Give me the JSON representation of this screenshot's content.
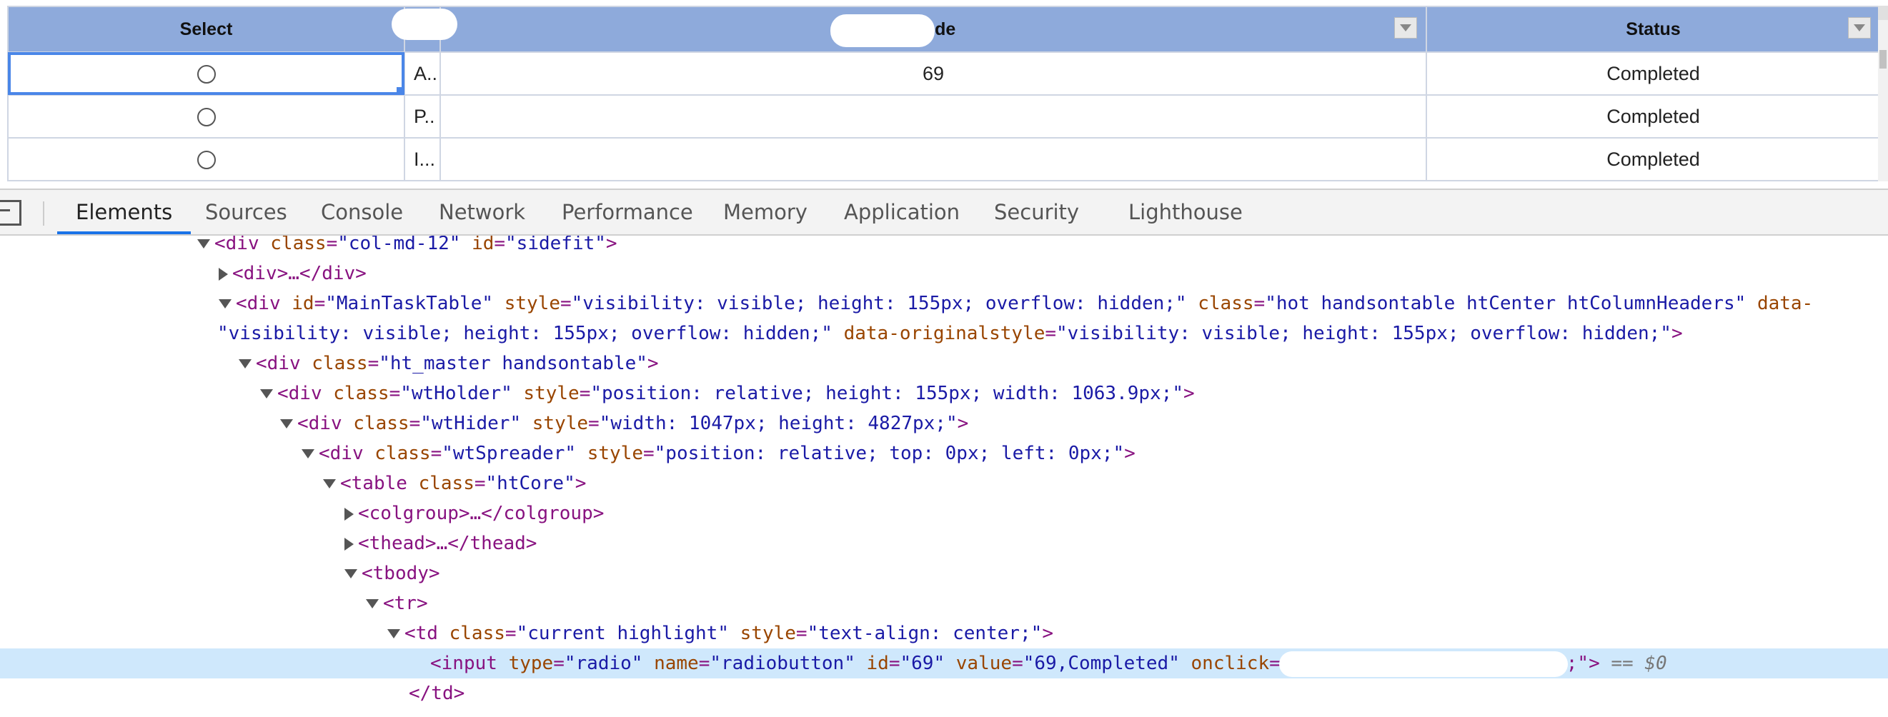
{
  "table": {
    "headers": {
      "select": "Select",
      "col2": "",
      "code": "Code",
      "status": "Status"
    },
    "rows": [
      {
        "col2": "A..",
        "code": "69",
        "status": "Completed"
      },
      {
        "col2": "P..",
        "code": "",
        "status": "Completed"
      },
      {
        "col2": "I...",
        "code": "",
        "status": "Completed"
      }
    ]
  },
  "devtools": {
    "tabs": [
      "Elements",
      "Sources",
      "Console",
      "Network",
      "Performance",
      "Memory",
      "Application",
      "Security",
      "Lighthouse"
    ],
    "active_tab": "Elements",
    "dom": {
      "l0": {
        "tag_open": "<div ",
        "a1": "class",
        "v1": "\"col-md-12\"",
        "a2": "id",
        "v2": "\"sidefit\"",
        "close": ">"
      },
      "l1": {
        "text": "<div>…</div>"
      },
      "l2": {
        "tag_open": "<div ",
        "a1": "id",
        "v1": "\"MainTaskTable\"",
        "a2": "style",
        "v2": "\"visibility: visible; height: 155px; overflow: hidden;\"",
        "a3": "class",
        "v3": "\"hot handsontable htCenter htColumnHeaders\"",
        "a4": "data-"
      },
      "l3": {
        "v": "\"visibility: visible; height: 155px; overflow: hidden;\"",
        "a": "data-originalstyle",
        "v2": "\"visibility: visible; height: 155px; overflow: hidden;\"",
        "close": ">"
      },
      "l4": {
        "tag_open": "<div ",
        "a1": "class",
        "v1": "\"ht_master handsontable\"",
        "close": ">"
      },
      "l5": {
        "tag_open": "<div ",
        "a1": "class",
        "v1": "\"wtHolder\"",
        "a2": "style",
        "v2": "\"position: relative; height: 155px; width: 1063.9px;\"",
        "close": ">"
      },
      "l6": {
        "tag_open": "<div ",
        "a1": "class",
        "v1": "\"wtHider\"",
        "a2": "style",
        "v2": "\"width: 1047px; height: 4827px;\"",
        "close": ">"
      },
      "l7": {
        "tag_open": "<div ",
        "a1": "class",
        "v1": "\"wtSpreader\"",
        "a2": "style",
        "v2": "\"position: relative; top: 0px; left: 0px;\"",
        "close": ">"
      },
      "l8": {
        "tag_open": "<table ",
        "a1": "class",
        "v1": "\"htCore\"",
        "close": ">"
      },
      "l9": {
        "text": "<colgroup>…</colgroup>"
      },
      "l10": {
        "text": "<thead>…</thead>"
      },
      "l11": {
        "text": "<tbody>"
      },
      "l12": {
        "text": "<tr>"
      },
      "l13": {
        "tag_open": "<td ",
        "a1": "class",
        "v1": "\"current highlight\"",
        "a2": "style",
        "v2": "\"text-align: center;\"",
        "close": ">"
      },
      "l14": {
        "tag_open": "<input ",
        "a1": "type",
        "v1": "\"radio\"",
        "a2": "name",
        "v2": "\"radiobutton\"",
        "a3": "id",
        "v3": "\"69\"",
        "a4": "value",
        "v4": "\"69,Completed\"",
        "a5": "onclick",
        "tail": ";\">",
        "eq": "== $0"
      },
      "l15": {
        "text": "</td>"
      }
    }
  }
}
